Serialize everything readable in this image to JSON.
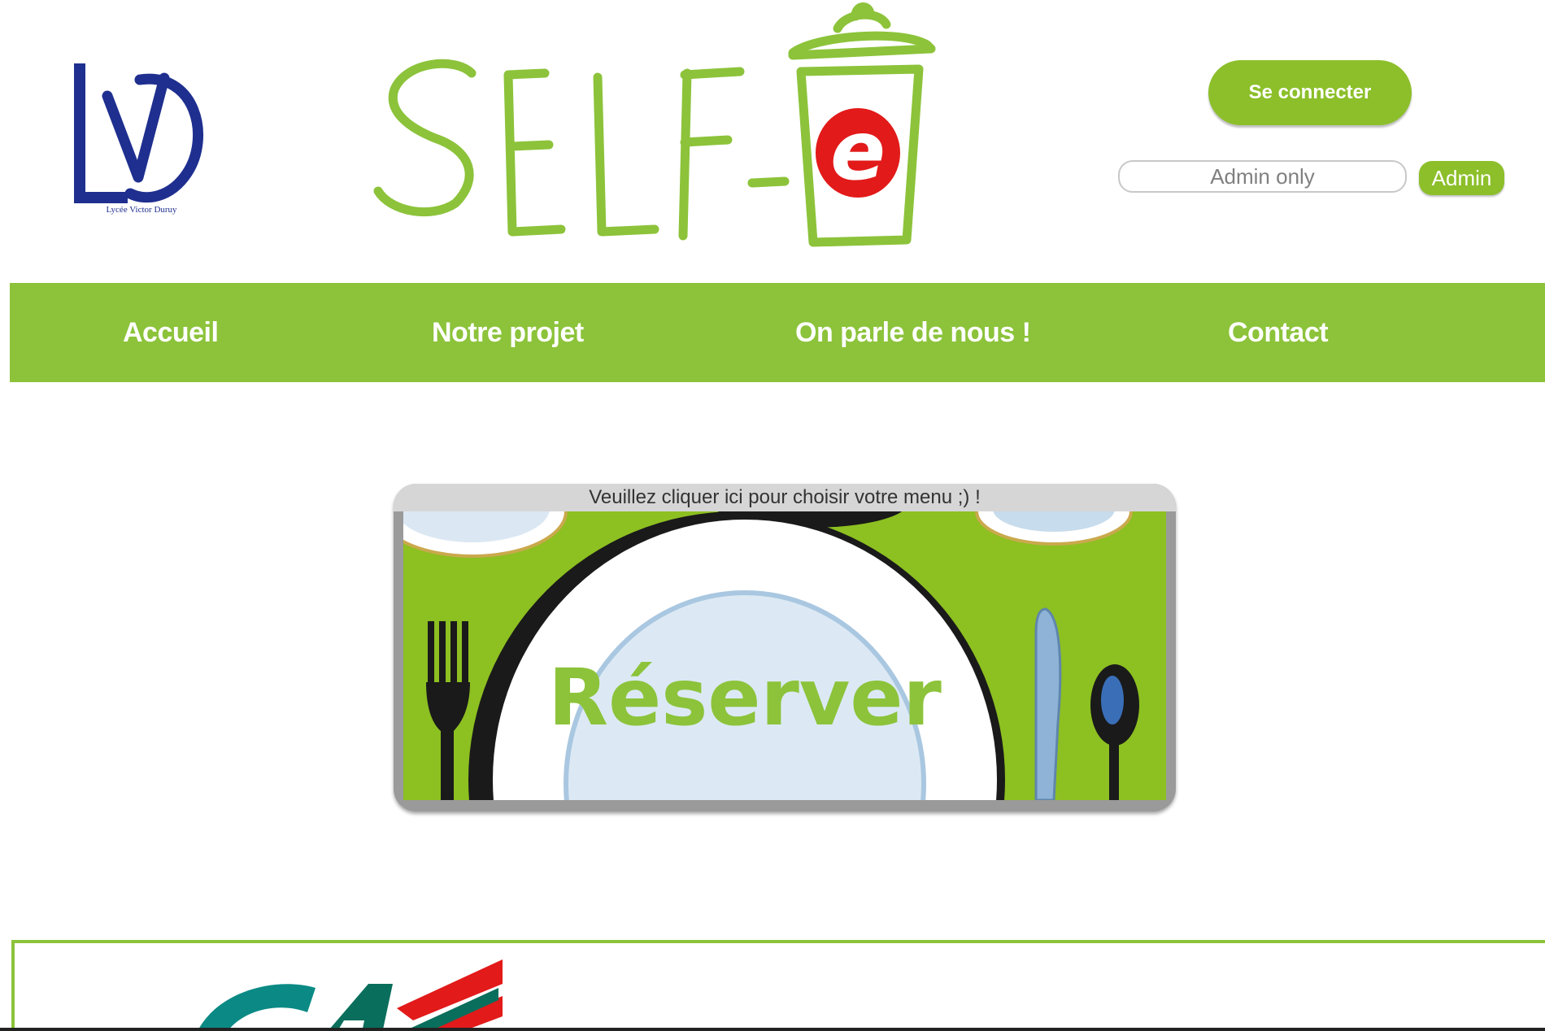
{
  "header": {
    "school_logo_caption": "Lycée Victor Duruy",
    "school_logo_subcaption": "",
    "site_logo_text": "SELF-e",
    "site_logo_accent": "e"
  },
  "account": {
    "connect_label": "Se connecter",
    "admin_placeholder": "Admin only",
    "admin_button_label": "Admin"
  },
  "nav": {
    "items": [
      {
        "label": "Accueil"
      },
      {
        "label": "Notre projet"
      },
      {
        "label": "On parle de nous !"
      },
      {
        "label": "Contact"
      }
    ]
  },
  "reserve": {
    "caption": "Veuillez cliquer ici pour choisir votre menu ;) !",
    "label": "Réserver"
  },
  "colors": {
    "brand_green": "#8cc33a",
    "accent_red": "#e21a1a",
    "school_blue": "#1f2f8f"
  }
}
